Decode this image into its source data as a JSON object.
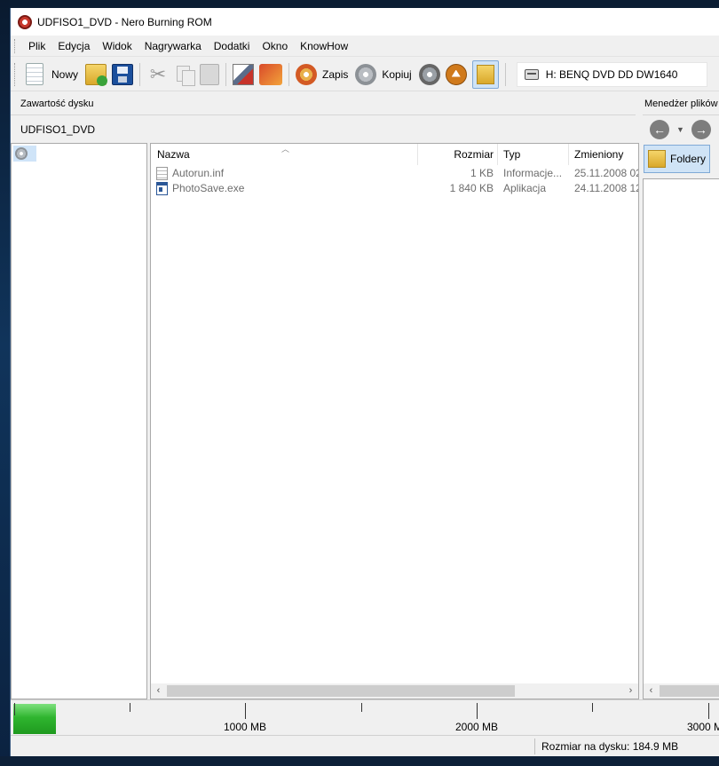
{
  "window": {
    "title": "UDFISO1_DVD - Nero Burning ROM"
  },
  "menu": {
    "items": [
      "Plik",
      "Edycja",
      "Widok",
      "Nagrywarka",
      "Dodatki",
      "Okno",
      "KnowHow"
    ]
  },
  "toolbar": {
    "new_label": "Nowy",
    "burn_label": "Zapis",
    "copy_label": "Kopiuj",
    "drive": "H: BENQ DVD DD DW1640",
    "icons": [
      "new-compilation-icon",
      "open-icon",
      "save-icon",
      "cut-icon",
      "copy-icon",
      "paste-icon",
      "compile-icon",
      "burn-image-icon",
      "burn-icon",
      "copy-disc-icon",
      "disc-info-icon",
      "eject-icon",
      "file-browser-icon",
      "drive-icon"
    ]
  },
  "compilation": {
    "header": "Zawartość dysku",
    "disc_name": "UDFISO1_DVD"
  },
  "filelist": {
    "columns": {
      "name": "Nazwa",
      "size": "Rozmiar",
      "type": "Typ",
      "modified": "Zmieniony"
    },
    "rows": [
      {
        "name": "Autorun.inf",
        "size": "1 KB",
        "type": "Informacje...",
        "modified": "25.11.2008 02:",
        "icon": "inf-file-icon"
      },
      {
        "name": "PhotoSave.exe",
        "size": "1 840 KB",
        "type": "Aplikacja",
        "modified": "24.11.2008 12:",
        "icon": "exe-file-icon"
      }
    ]
  },
  "file_manager": {
    "header": "Menedżer plików",
    "folders_label": "Foldery"
  },
  "capacity": {
    "used_mb": 184.9,
    "ticks": [
      "1000 MB",
      "2000 MB",
      "3000 MB"
    ],
    "fill_color": "#2fb52f"
  },
  "status": {
    "disc_size": "Rozmiar na dysku: 184.9 MB"
  }
}
